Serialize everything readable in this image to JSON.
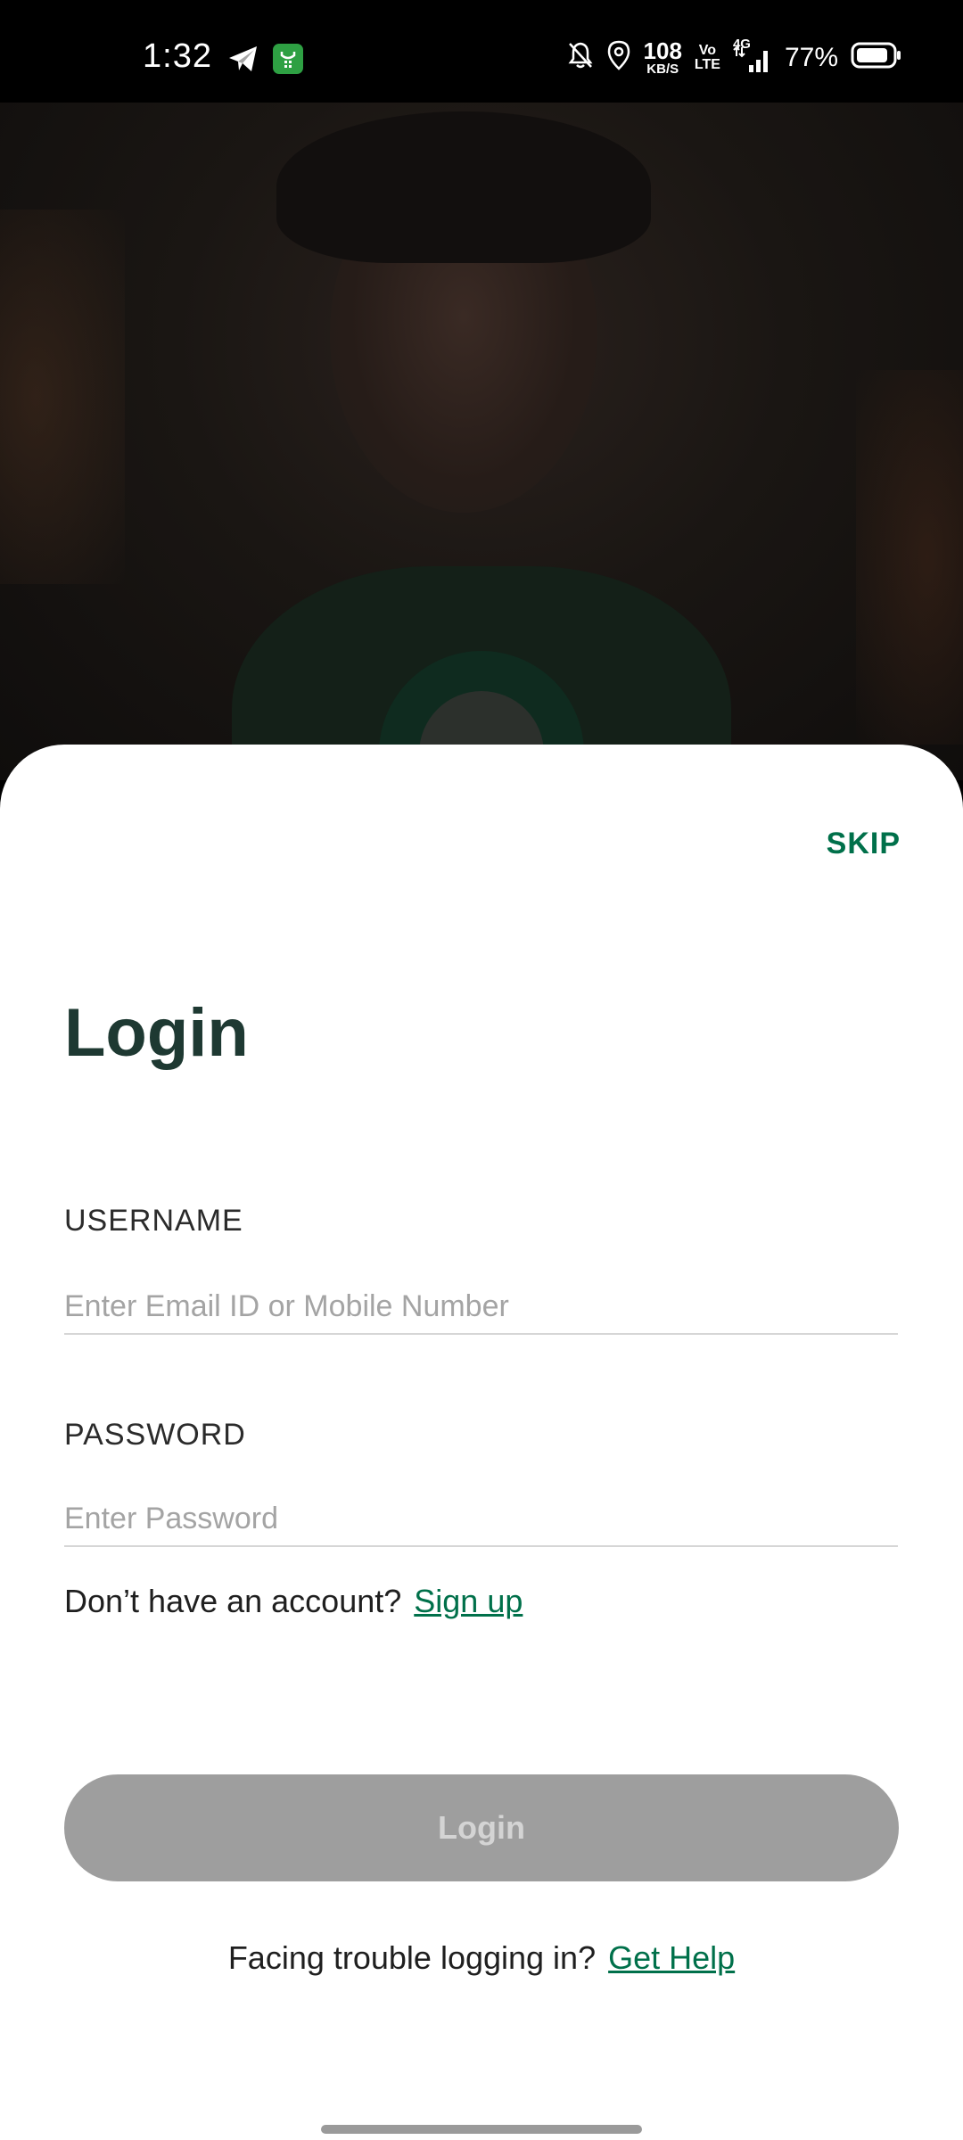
{
  "status_bar": {
    "time": "1:32",
    "net_speed_value": "108",
    "net_speed_unit": "KB/S",
    "volte_top": "Vo",
    "volte_bottom": "LTE",
    "network": "4G",
    "battery_percent": "77%",
    "icons": [
      "telegram-icon",
      "app-notification-icon",
      "bell-off-icon",
      "location-icon",
      "signal-icon",
      "battery-icon"
    ]
  },
  "hero": {
    "description_icon": "barista-photo-image"
  },
  "sheet": {
    "skip_label": "SKIP",
    "title": "Login",
    "username": {
      "label": "USERNAME",
      "placeholder": "Enter Email ID or Mobile Number",
      "value": ""
    },
    "password": {
      "label": "PASSWORD",
      "placeholder": "Enter Password",
      "value": ""
    },
    "signup_prompt": "Don’t have an account?",
    "signup_link": "Sign up",
    "login_button": "Login",
    "help_prompt": "Facing trouble logging in?",
    "help_link": "Get Help"
  },
  "colors": {
    "brand_green": "#00704a",
    "title_dark_green": "#1e3932",
    "button_disabled": "#9e9e9e"
  }
}
